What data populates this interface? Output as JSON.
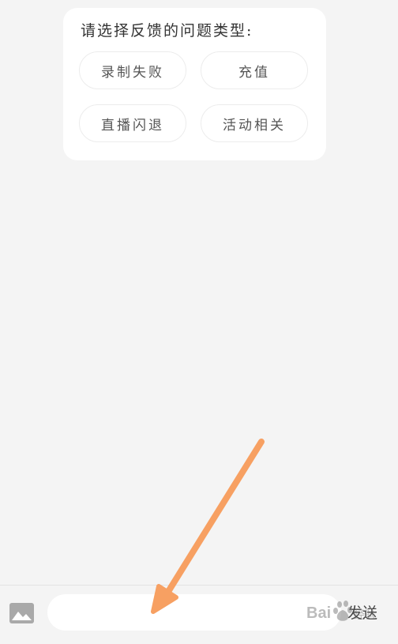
{
  "feedback": {
    "title": "请选择反馈的问题类型:",
    "options": [
      {
        "label": "录制失败"
      },
      {
        "label": "充值"
      },
      {
        "label": "直播闪退"
      },
      {
        "label": "活动相关"
      }
    ]
  },
  "composer": {
    "image_icon": "image-icon",
    "input_value": "",
    "send_label": "发送"
  },
  "annotation": {
    "arrow_color": "#f7a062"
  },
  "watermark": {
    "text": "Bai 经验",
    "icon": "baidu-paw-icon"
  },
  "colors": {
    "background": "#f4f4f4",
    "card": "#ffffff",
    "text": "#333333",
    "chip_border": "#ececec"
  }
}
